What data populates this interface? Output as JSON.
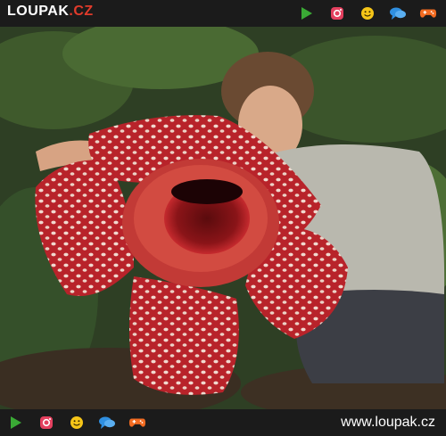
{
  "header": {
    "logo_main": "LOUPAK",
    "logo_tld": ".CZ"
  },
  "icons": [
    "play-icon",
    "instagram-icon",
    "smiley-icon",
    "chat-icon",
    "gamepad-icon"
  ],
  "footer": {
    "site_url": "www.loupak.cz"
  },
  "colors": {
    "bar": "#1b1b1b",
    "play": "#3aa935",
    "instagram": "#e4405f",
    "smiley": "#f5c518",
    "chat": "#2f8fe0",
    "gamepad": "#f26b21",
    "flower": "#b8232a"
  }
}
